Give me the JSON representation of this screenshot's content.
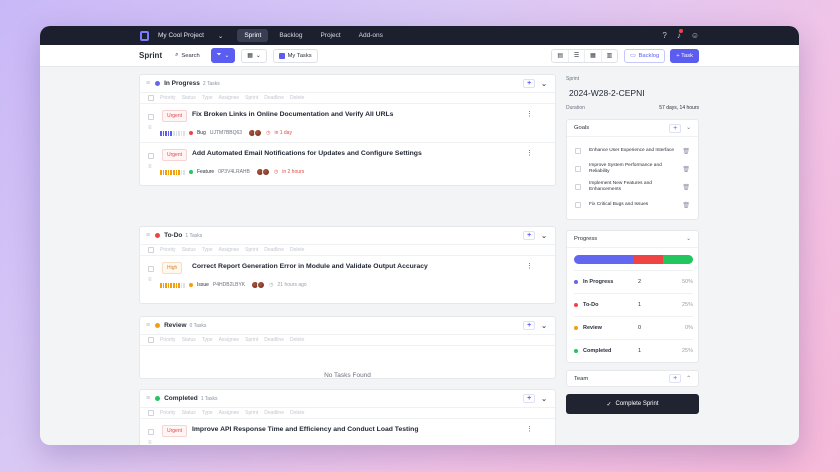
{
  "topbar": {
    "project": "My Cool Project",
    "nav": [
      "Sprint",
      "Backlog",
      "Project",
      "Add-ons"
    ]
  },
  "subbar": {
    "title": "Sprint",
    "search": "Search",
    "my_tasks": "My Tasks",
    "backlog": "Backlog",
    "task": "+ Task"
  },
  "columns": [
    "Priority",
    "Status",
    "Type",
    "Assignee",
    "Sprint",
    "Deadline",
    "Delete"
  ],
  "groups": [
    {
      "name": "In Progress",
      "count": "2 Tasks",
      "color": "#6366f1",
      "tasks": [
        {
          "tag": "Urgent",
          "title": "Fix Broken Links in Online Documentation and Verify All URLs",
          "type": "Bug",
          "type_color": "#ef4444",
          "id": "UJTM7BBQ63",
          "due": "in 1 day",
          "bar_color": "#5b5cf0",
          "bar_fill": 0.5
        },
        {
          "tag": "Urgent",
          "title": "Add Automated Email Notifications for Updates and Configure Settings",
          "type": "Feature",
          "type_color": "#22c55e",
          "id": "0P3V4LRAHB",
          "due": "in 2 hours",
          "bar_color": "#f59e0b",
          "bar_fill": 0.75
        }
      ]
    },
    {
      "name": "To-Do",
      "count": "1 Tasks",
      "color": "#ef4444",
      "tasks": [
        {
          "tag": "High",
          "title": "Correct Report Generation Error in Module and Validate Output Accuracy",
          "type": "Issue",
          "type_color": "#f59e0b",
          "id": "P4HDB2LBYK",
          "due": "21 hours ago",
          "bar_color": "#f59e0b",
          "bar_fill": 0.75
        }
      ]
    },
    {
      "name": "Review",
      "count": "0 Tasks",
      "color": "#f59e0b",
      "empty": "No Tasks Found",
      "tasks": []
    },
    {
      "name": "Completed",
      "count": "1 Tasks",
      "color": "#22c55e",
      "tasks": [
        {
          "tag": "Urgent",
          "title": "Improve API Response Time and Efficiency and Conduct Load Testing",
          "type": "Improvement",
          "type_color": "#6366f1",
          "id": "Y1XWT39Z9U",
          "due": "2 days ago",
          "bar_color": "#ef4444",
          "bar_fill": 1.0
        }
      ]
    }
  ],
  "sidebar": {
    "label": "Sprint",
    "sprint_name": "2024-W28-2-CEPNI",
    "duration_label": "Duration",
    "duration": "57 days, 14 hours",
    "goals_title": "Goals",
    "goals": [
      "Enhance User Experience and Interface",
      "Improve System Performance and Reliability",
      "Implement New Features and Enhancements",
      "Fix Critical Bugs and Issues"
    ],
    "progress_title": "Progress",
    "progress": [
      {
        "name": "In Progress",
        "count": "2",
        "pct": "50%",
        "color": "#6366f1",
        "value": 0.5
      },
      {
        "name": "To-Do",
        "count": "1",
        "pct": "25%",
        "color": "#ef4444",
        "value": 0.25
      },
      {
        "name": "Review",
        "count": "0",
        "pct": "0%",
        "color": "#f59e0b",
        "value": 0
      },
      {
        "name": "Completed",
        "count": "1",
        "pct": "25%",
        "color": "#22c55e",
        "value": 0.25
      }
    ],
    "team_title": "Team",
    "complete_button": "Complete Sprint"
  }
}
